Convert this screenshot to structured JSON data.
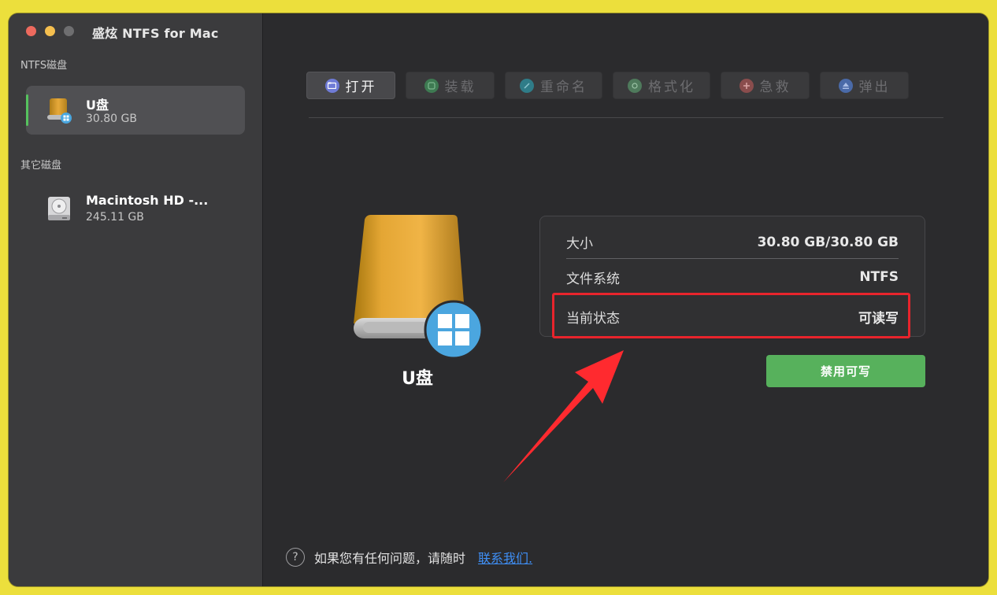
{
  "app": {
    "title": "盛炫 NTFS for Mac"
  },
  "sidebar": {
    "ntfs_section": "NTFS磁盘",
    "other_section": "其它磁盘",
    "ntfs_disks": [
      {
        "name": "U盘",
        "size": "30.80 GB",
        "icon": "usb-drive-windows-icon",
        "selected": true
      }
    ],
    "other_disks": [
      {
        "name": "Macintosh HD -...",
        "size": "245.11 GB",
        "icon": "hard-disk-icon",
        "selected": false
      }
    ]
  },
  "toolbar": {
    "buttons": [
      {
        "label": "打开",
        "icon": "folder-icon",
        "active": true,
        "color": "#6f7bd6"
      },
      {
        "label": "装载",
        "icon": "mount-icon",
        "active": false,
        "color": "#3e7a52"
      },
      {
        "label": "重命名",
        "icon": "rename-icon",
        "active": false,
        "color": "#2f7c88"
      },
      {
        "label": "格式化",
        "icon": "format-icon",
        "active": false,
        "color": "#4f7a5c"
      },
      {
        "label": "急救",
        "icon": "first-aid-icon",
        "active": false,
        "color": "#8a4d4d"
      },
      {
        "label": "弹出",
        "icon": "eject-icon",
        "active": false,
        "color": "#4a6aa8"
      }
    ]
  },
  "disk_detail": {
    "name": "U盘",
    "rows": [
      {
        "label": "大小",
        "value": "30.80 GB/30.80 GB"
      },
      {
        "label": "文件系统",
        "value": "NTFS"
      },
      {
        "label": "当前状态",
        "value": "可读写"
      }
    ],
    "action_label": "禁用可写"
  },
  "footer": {
    "help_symbol": "?",
    "text": "如果您有任何问题，请随时",
    "link": "联系我们."
  },
  "colors": {
    "accent_green": "#57b15c",
    "highlight_red": "#e8242c",
    "link_blue": "#3f8ff5"
  }
}
